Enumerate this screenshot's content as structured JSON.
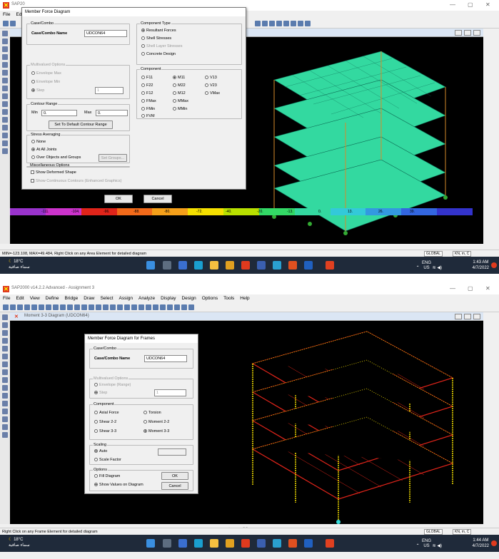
{
  "shot1": {
    "title": "SAP20",
    "menu": [
      "File",
      "Ed"
    ],
    "dialog": {
      "title": "Member Force Diagram",
      "case_group": "Case/Combo",
      "case_label": "Case/Combo Name",
      "case_value": "UDCON64",
      "mv_group": "Multivalued Options",
      "mv_env_max": "Envelope Max",
      "mv_env_min": "Envelope Min",
      "mv_step": "Step",
      "mv_step_value": "1",
      "contour_group": "Contour Range",
      "min_label": "Min",
      "min_value": "0.",
      "max_label": "Max",
      "max_value": "0.",
      "default_btn": "Set To Default Contour Range",
      "avg_group": "Stress Averaging",
      "avg_none": "None",
      "avg_all": "At All Joints",
      "avg_over": "Over Objects and Groups",
      "set_groups": "Set Groups...",
      "misc_group": "Miscellaneous Options",
      "show_deformed": "Show Deformed Shape",
      "show_cont": "Show Continuous Contours (Enhanced Graphics)",
      "ok": "OK",
      "cancel": "Cancel",
      "type_group": "Component Type",
      "type_resultant": "Resultant Forces",
      "type_shell": "Shell Stresses",
      "type_layered": "Shell Layer Stresses",
      "type_concrete": "Concrete Design",
      "comp_group": "Component",
      "components": [
        "F11",
        "M11",
        "V13",
        "F22",
        "M22",
        "V23",
        "F12",
        "M12",
        "VMax",
        "FMax",
        "MMax",
        "FMin",
        "MMin",
        "FVM"
      ]
    },
    "colorbar_labels": [
      "-111.",
      "-104.",
      "-96.",
      "-88.",
      "-80.",
      "-72.",
      "-40.",
      "-20.",
      "-13.",
      "0.",
      "13.",
      "26.",
      "39."
    ],
    "status": "MIN=-123.108, MAX=49.484, Right Click on any Area Element for detailed diagram",
    "units": "KN, m, C",
    "coord": "GLOBAL",
    "weather_temp": "18°C",
    "weather_desc": "سماء صافية",
    "lang": "ENG",
    "region": "US",
    "time": "1:43 AM",
    "date": "4/7/2022"
  },
  "shot2": {
    "title": "SAP2000 v14.2.2 Advanced  - Assignment 3",
    "menu": [
      "File",
      "Edit",
      "View",
      "Define",
      "Bridge",
      "Draw",
      "Select",
      "Assign",
      "Analyze",
      "Display",
      "Design",
      "Options",
      "Tools",
      "Help"
    ],
    "window_title": "Moment 3-3 Diagram  (UDCON64)",
    "dialog": {
      "title": "Member Force Diagram for Frames",
      "case_group": "Case/Combo",
      "case_label": "Case/Combo Name",
      "case_value": "UDCON64",
      "mv_group": "Multivalued Options",
      "mv_env": "Envelope (Range)",
      "mv_step": "Step",
      "mv_step_value": "1",
      "comp_group": "Component",
      "axial": "Axial Force",
      "torsion": "Torsion",
      "shear22": "Shear 2-2",
      "moment22": "Moment 2-2",
      "shear33": "Shear 3-3",
      "moment33": "Moment 3-3",
      "scaling_group": "Scaling",
      "auto": "Auto",
      "scale_factor": "Scale Factor",
      "options_group": "Options",
      "fill": "Fill Diagram",
      "show_values": "Show Values on Diagram",
      "ok": "OK",
      "cancel": "Cancel"
    },
    "status": "Right Click on any Frame Element for detailed diagram",
    "units": "KN, m, C",
    "coord": "GLOBAL",
    "weather_temp": "18°C",
    "weather_desc": "سماء صافية",
    "lang": "ENG",
    "region": "US",
    "time": "1:44 AM",
    "date": "4/7/2022",
    "watermark": "mostaqil.com"
  },
  "colors": {
    "canvas": "#000000",
    "building_green": "#33d9a0",
    "building_red": "#e0241a",
    "yellow": "#f5e000",
    "taskbar": "#1f2a3a"
  }
}
